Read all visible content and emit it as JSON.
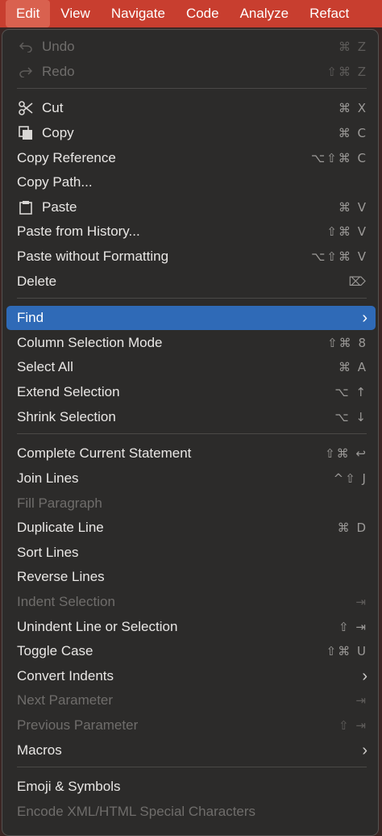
{
  "menubar": {
    "items": [
      "Edit",
      "View",
      "Navigate",
      "Code",
      "Analyze",
      "Refact"
    ]
  },
  "colors": {
    "menubar_bg": "#c83e2f",
    "menu_bg": "#2c2b2a",
    "selection": "#2f6ab7"
  },
  "menu": {
    "undo": {
      "label": "Undo",
      "shortcut": "⌘ Z",
      "icon": "undo-icon",
      "enabled": false
    },
    "redo": {
      "label": "Redo",
      "shortcut": "⇧⌘ Z",
      "icon": "redo-icon",
      "enabled": false
    },
    "cut": {
      "label": "Cut",
      "shortcut": "⌘ X",
      "icon": "scissors-icon"
    },
    "copy": {
      "label": "Copy",
      "shortcut": "⌘ C",
      "icon": "copy-icon"
    },
    "copy_reference": {
      "label": "Copy Reference",
      "shortcut": "⌥⇧⌘ C"
    },
    "copy_path": {
      "label": "Copy Path...",
      "shortcut": ""
    },
    "paste": {
      "label": "Paste",
      "shortcut": "⌘ V",
      "icon": "clipboard-icon"
    },
    "paste_history": {
      "label": "Paste from History...",
      "shortcut": "⇧⌘ V"
    },
    "paste_plain": {
      "label": "Paste without Formatting",
      "shortcut": "⌥⇧⌘ V"
    },
    "delete": {
      "label": "Delete",
      "shortcut": "⌦"
    },
    "find": {
      "label": "Find",
      "submenu": true,
      "selected": true
    },
    "column_mode": {
      "label": "Column Selection Mode",
      "shortcut": "⇧⌘ 8"
    },
    "select_all": {
      "label": "Select All",
      "shortcut": "⌘ A"
    },
    "extend_selection": {
      "label": "Extend Selection",
      "shortcut": "⌥ ↑"
    },
    "shrink_selection": {
      "label": "Shrink Selection",
      "shortcut": "⌥ ↓"
    },
    "complete_statement": {
      "label": "Complete Current Statement",
      "shortcut": "⇧⌘ ↩"
    },
    "join_lines": {
      "label": "Join Lines",
      "shortcut": "^⇧ J"
    },
    "fill_paragraph": {
      "label": "Fill Paragraph",
      "shortcut": "",
      "enabled": false
    },
    "duplicate_line": {
      "label": "Duplicate Line",
      "shortcut": "⌘ D"
    },
    "sort_lines": {
      "label": "Sort Lines",
      "shortcut": ""
    },
    "reverse_lines": {
      "label": "Reverse Lines",
      "shortcut": ""
    },
    "indent_selection": {
      "label": "Indent Selection",
      "shortcut": "⇥",
      "enabled": false
    },
    "unindent": {
      "label": "Unindent Line or Selection",
      "shortcut": "⇧ ⇥"
    },
    "toggle_case": {
      "label": "Toggle Case",
      "shortcut": "⇧⌘ U"
    },
    "convert_indents": {
      "label": "Convert Indents",
      "submenu": true
    },
    "next_parameter": {
      "label": "Next Parameter",
      "shortcut": "⇥",
      "enabled": false
    },
    "previous_parameter": {
      "label": "Previous Parameter",
      "shortcut": "⇧ ⇥",
      "enabled": false
    },
    "macros": {
      "label": "Macros",
      "submenu": true
    },
    "emoji": {
      "label": "Emoji & Symbols",
      "shortcut": ""
    },
    "encode_xml": {
      "label": "Encode XML/HTML Special Characters",
      "shortcut": "",
      "enabled": false
    }
  }
}
